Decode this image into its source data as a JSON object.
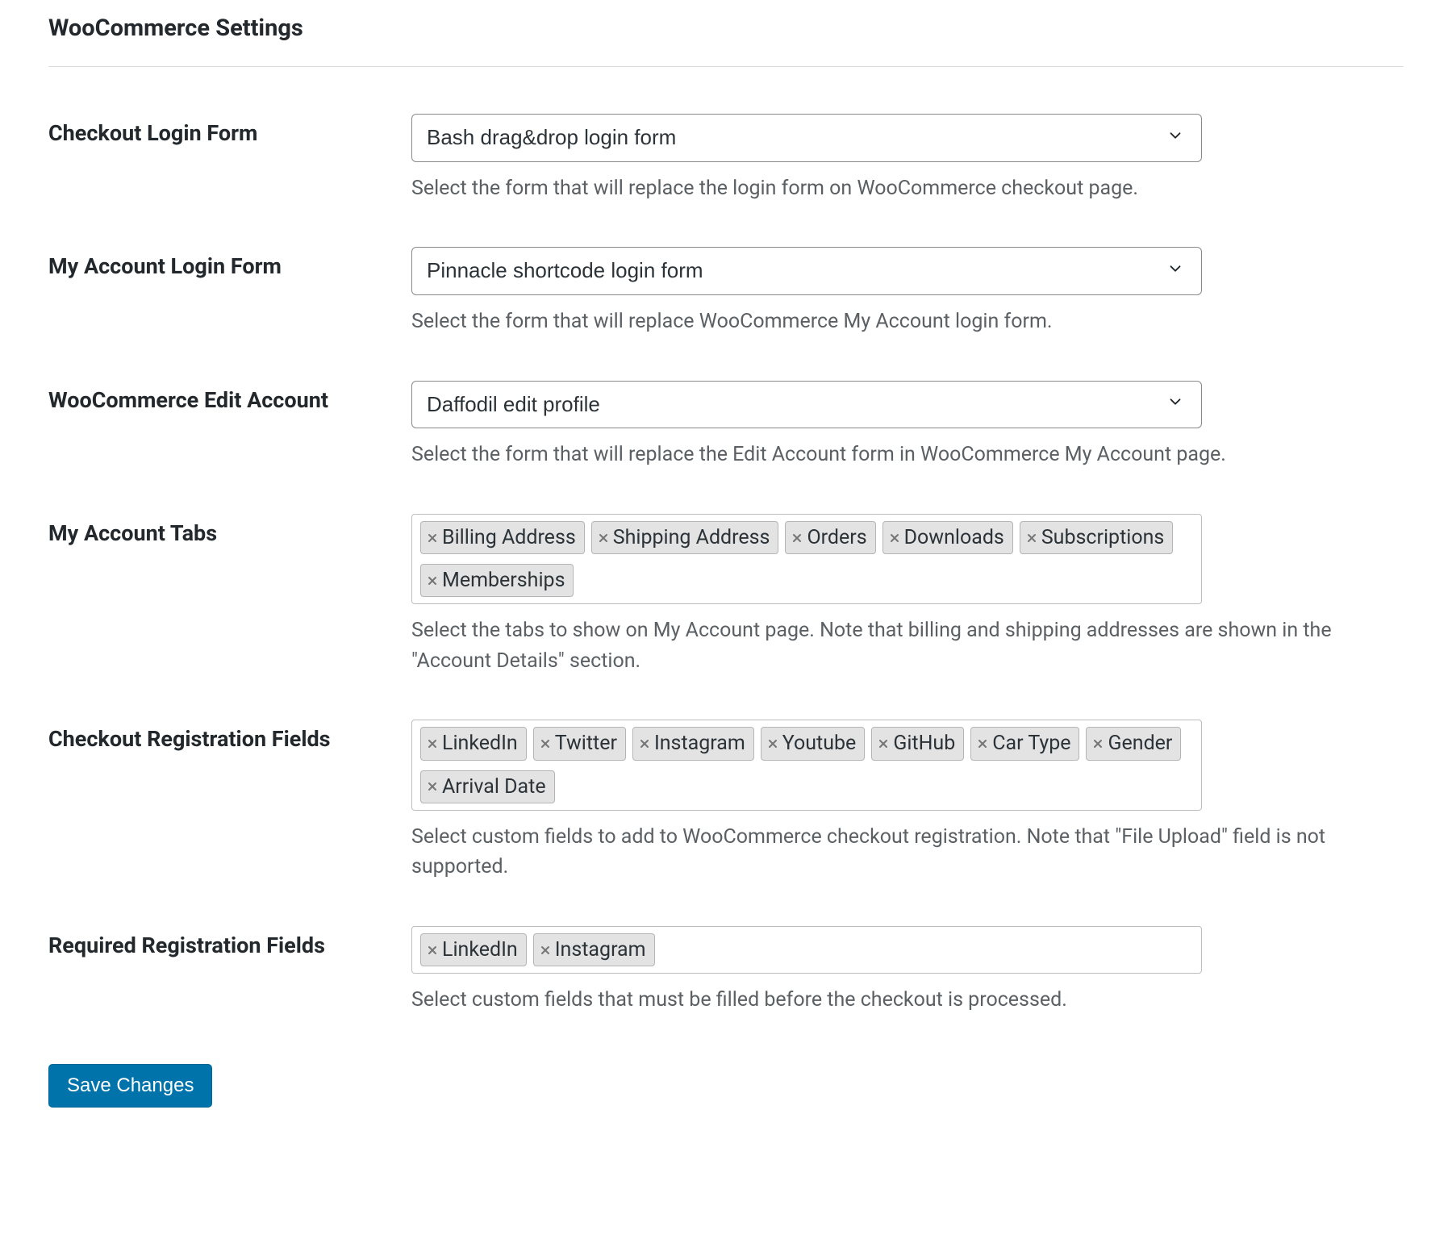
{
  "page_title": "WooCommerce Settings",
  "fields": {
    "checkout_login_form": {
      "label": "Checkout Login Form",
      "value": "Bash drag&drop login form",
      "description": "Select the form that will replace the login form on WooCommerce checkout page."
    },
    "my_account_login_form": {
      "label": "My Account Login Form",
      "value": "Pinnacle shortcode login form",
      "description": "Select the form that will replace WooCommerce My Account login form."
    },
    "woocommerce_edit_account": {
      "label": "WooCommerce Edit Account",
      "value": "Daffodil edit profile",
      "description": "Select the form that will replace the Edit Account form in WooCommerce My Account page."
    },
    "my_account_tabs": {
      "label": "My Account Tabs",
      "tags": [
        "Billing Address",
        "Shipping Address",
        "Orders",
        "Downloads",
        "Subscriptions",
        "Memberships"
      ],
      "description": "Select the tabs to show on My Account page. Note that billing and shipping addresses are shown in the \"Account Details\" section."
    },
    "checkout_registration_fields": {
      "label": "Checkout Registration Fields",
      "tags": [
        "LinkedIn",
        "Twitter",
        "Instagram",
        "Youtube",
        "GitHub",
        "Car Type",
        "Gender",
        "Arrival Date"
      ],
      "description": "Select custom fields to add to WooCommerce checkout registration. Note that \"File Upload\" field is not supported."
    },
    "required_registration_fields": {
      "label": "Required Registration Fields",
      "tags": [
        "LinkedIn",
        "Instagram"
      ],
      "description": "Select custom fields that must be filled before the checkout is processed."
    }
  },
  "save_button_label": "Save Changes",
  "icons": {
    "chevron_down": "chevron-down-icon",
    "close_x": "close-icon"
  },
  "colors": {
    "primary": "#0073aa",
    "text": "#23282d",
    "muted": "#5b6064",
    "border": "#bdbdbd",
    "tag_bg": "#e3e3e3",
    "tag_border": "#b5b5b5"
  }
}
